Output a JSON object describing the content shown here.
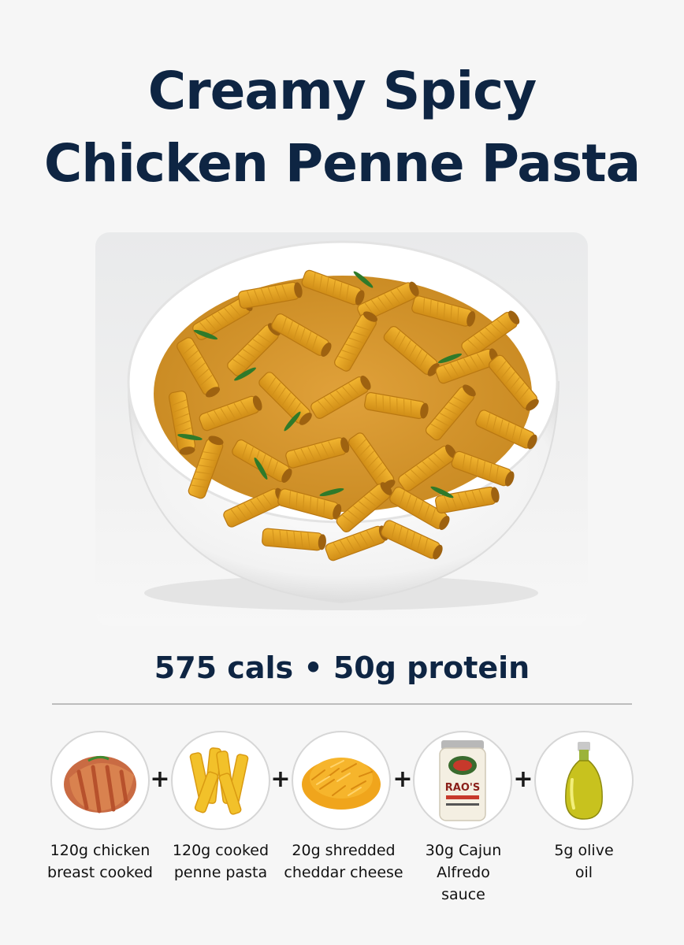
{
  "title": {
    "line1": "Creamy Spicy",
    "line2": "Chicken Penne Pasta"
  },
  "photo": {
    "subject": "bowl-of-penne-pasta"
  },
  "macros": "575 cals • 50g protein",
  "plus_symbol": "+",
  "ingredients": [
    {
      "label": "120g chicken\nbreast cooked",
      "icon": "chicken-breast-icon"
    },
    {
      "label": "120g cooked\npenne pasta",
      "icon": "penne-pasta-icon"
    },
    {
      "label": "20g shredded\ncheddar cheese",
      "icon": "shredded-cheese-icon"
    },
    {
      "label": "30g Cajun\nAlfredo\nsauce",
      "icon": "alfredo-sauce-jar-icon",
      "jar_text": "RAO'S"
    },
    {
      "label": "5g olive\noil",
      "icon": "olive-oil-bottle-icon"
    }
  ],
  "colors": {
    "title": "#0e2543",
    "background": "#f6f6f6",
    "pasta": "#e8a41f",
    "divider": "#bdbdbd"
  }
}
